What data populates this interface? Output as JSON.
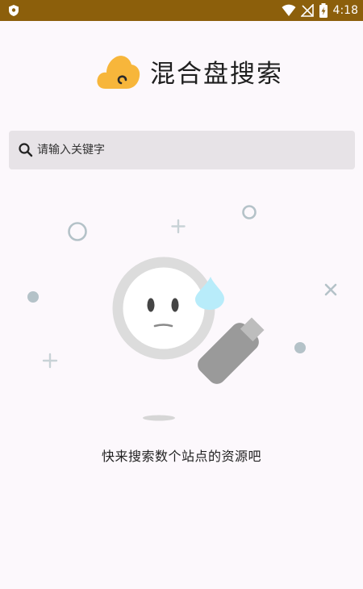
{
  "status_bar": {
    "time": "4:18",
    "icons": [
      "shield-icon",
      "wifi-icon",
      "no-signal-icon",
      "battery-charging-icon"
    ]
  },
  "header": {
    "title": "混合盘搜索",
    "logo_icon": "cloud-logo-icon"
  },
  "search": {
    "placeholder": "请输入关键字",
    "value": "",
    "icon": "search-icon"
  },
  "empty_state": {
    "message": "快来搜索数个站点的资源吧",
    "illustration": "sad-magnifier-illustration"
  },
  "colors": {
    "status_bar_bg": "#8c5f0b",
    "background": "#fcf8fc",
    "search_bg": "#e7e3e7",
    "logo": "#f7b63b",
    "drop": "#b8ecfa"
  }
}
